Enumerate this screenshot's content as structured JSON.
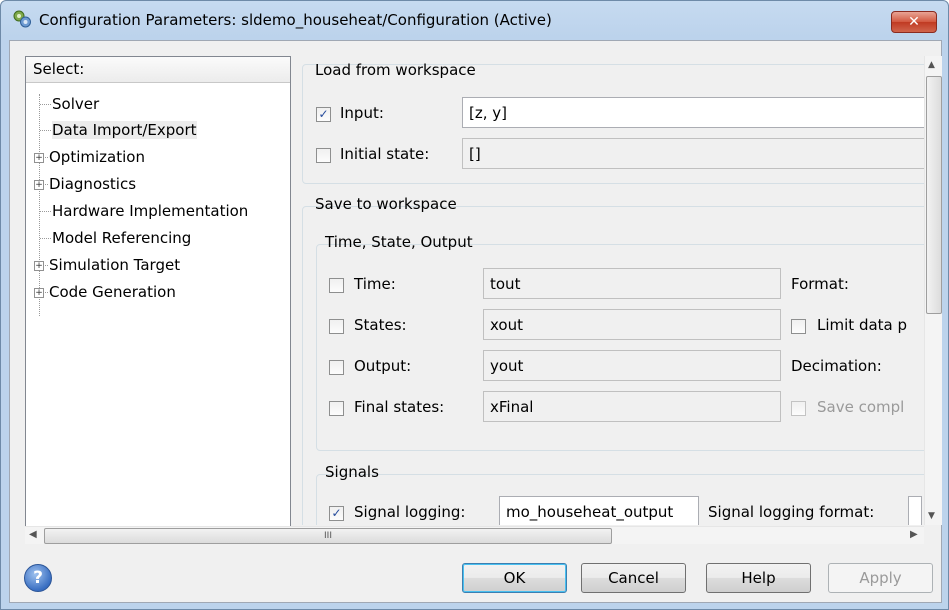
{
  "window": {
    "title": "Configuration Parameters: sldemo_househeat/Configuration (Active)",
    "close_label": "✕"
  },
  "tree": {
    "header": "Select:",
    "items": [
      {
        "label": "Solver",
        "expandable": false
      },
      {
        "label": "Data Import/Export",
        "expandable": false,
        "selected": true
      },
      {
        "label": "Optimization",
        "expandable": true
      },
      {
        "label": "Diagnostics",
        "expandable": true
      },
      {
        "label": "Hardware Implementation",
        "expandable": false
      },
      {
        "label": "Model Referencing",
        "expandable": false
      },
      {
        "label": "Simulation Target",
        "expandable": true
      },
      {
        "label": "Code Generation",
        "expandable": true
      }
    ]
  },
  "load_group": {
    "title": "Load from workspace",
    "input_label": "Input:",
    "input_checked": true,
    "input_value": "[z, y]",
    "initial_state_label": "Initial state:",
    "initial_state_checked": false,
    "initial_state_value": "[]"
  },
  "save_group": {
    "title": "Save to workspace",
    "subgroup_title": "Time, State, Output",
    "time_label": "Time:",
    "time_value": "tout",
    "states_label": "States:",
    "states_value": "xout",
    "output_label": "Output:",
    "output_value": "yout",
    "final_states_label": "Final states:",
    "final_states_value": "xFinal",
    "format_label": "Format:",
    "limit_data_label": "Limit data p",
    "decimation_label": "Decimation:",
    "save_compl_label": "Save compl"
  },
  "signals_group": {
    "title": "Signals",
    "signal_logging_label": "Signal logging:",
    "signal_logging_checked": true,
    "signal_logging_value": "mo_househeat_output",
    "signal_logging_format_label": "Signal logging format:"
  },
  "scroll": {
    "h_thumb_grip": "III"
  },
  "buttons": {
    "help_icon": "?",
    "ok": "OK",
    "cancel": "Cancel",
    "help": "Help",
    "apply": "Apply"
  }
}
